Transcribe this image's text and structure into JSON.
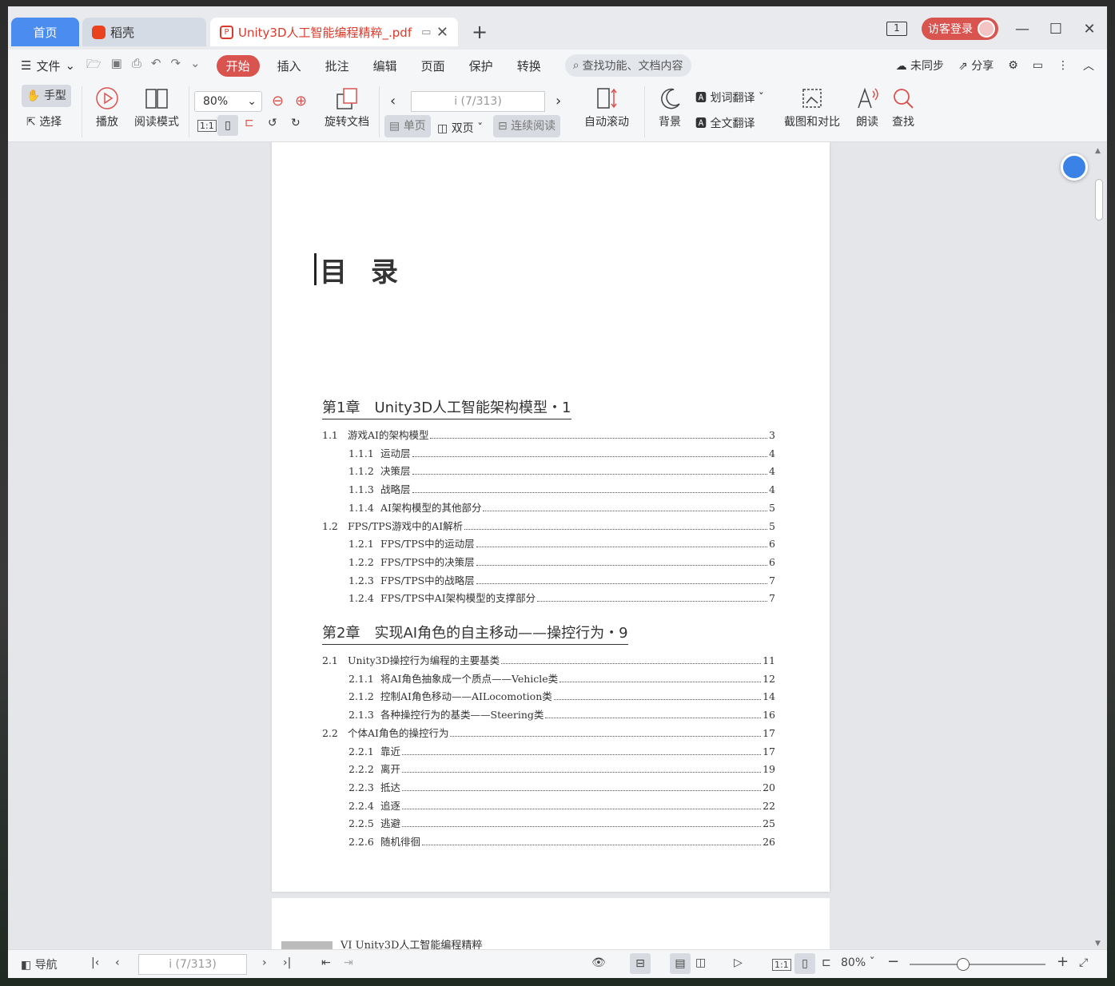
{
  "tabs": {
    "home": "首页",
    "daoke": "稻壳",
    "doc": "Unity3D人工智能编程精粹_.pdf"
  },
  "titlebar": {
    "window_count": "1",
    "login": "访客登录"
  },
  "menu": {
    "file": "文件",
    "items": [
      "开始",
      "插入",
      "批注",
      "编辑",
      "页面",
      "保护",
      "转换"
    ],
    "search_placeholder": "查找功能、文档内容",
    "sync": "未同步",
    "share": "分享"
  },
  "ribbon": {
    "hand": "手型",
    "select": "选择",
    "play": "播放",
    "read_mode": "阅读模式",
    "zoom": "80%",
    "rotate": "旋转文档",
    "page_indicator": "i (7/313)",
    "single": "单页",
    "double": "双页",
    "continuous": "连续阅读",
    "auto_scroll": "自动滚动",
    "background": "背景",
    "word_translate": "划词翻译",
    "full_translate": "全文翻译",
    "screenshot": "截图和对比",
    "read_aloud": "朗读",
    "find": "查找"
  },
  "document": {
    "toc_title": "目录",
    "chapters": [
      {
        "title": "第1章　Unity3D人工智能架构模型・1",
        "entries": [
          {
            "num": "1.1",
            "text": "游戏AI的架构模型",
            "page": "3",
            "sub": false
          },
          {
            "num": "1.1.1",
            "text": "运动层",
            "page": "4",
            "sub": true
          },
          {
            "num": "1.1.2",
            "text": "决策层",
            "page": "4",
            "sub": true
          },
          {
            "num": "1.1.3",
            "text": "战略层",
            "page": "4",
            "sub": true
          },
          {
            "num": "1.1.4",
            "text": "AI架构模型的其他部分",
            "page": "5",
            "sub": true
          },
          {
            "num": "1.2",
            "text": "FPS/TPS游戏中的AI解析",
            "page": "5",
            "sub": false
          },
          {
            "num": "1.2.1",
            "text": "FPS/TPS中的运动层",
            "page": "6",
            "sub": true
          },
          {
            "num": "1.2.2",
            "text": "FPS/TPS中的决策层",
            "page": "6",
            "sub": true
          },
          {
            "num": "1.2.3",
            "text": "FPS/TPS中的战略层",
            "page": "7",
            "sub": true
          },
          {
            "num": "1.2.4",
            "text": "FPS/TPS中AI架构模型的支撑部分",
            "page": "7",
            "sub": true
          }
        ]
      },
      {
        "title": "第2章　实现AI角色的自主移动——操控行为・9",
        "entries": [
          {
            "num": "2.1",
            "text": "Unity3D操控行为编程的主要基类",
            "page": "11",
            "sub": false
          },
          {
            "num": "2.1.1",
            "text": "将AI角色抽象成一个质点——Vehicle类",
            "page": "12",
            "sub": true
          },
          {
            "num": "2.1.2",
            "text": "控制AI角色移动——AILocomotion类",
            "page": "14",
            "sub": true
          },
          {
            "num": "2.1.3",
            "text": "各种操控行为的基类——Steering类",
            "page": "16",
            "sub": true
          },
          {
            "num": "2.2",
            "text": "个体AI角色的操控行为",
            "page": "17",
            "sub": false
          },
          {
            "num": "2.2.1",
            "text": "靠近",
            "page": "17",
            "sub": true
          },
          {
            "num": "2.2.2",
            "text": "离开",
            "page": "19",
            "sub": true
          },
          {
            "num": "2.2.3",
            "text": "抵达",
            "page": "20",
            "sub": true
          },
          {
            "num": "2.2.4",
            "text": "追逐",
            "page": "22",
            "sub": true
          },
          {
            "num": "2.2.5",
            "text": "逃避",
            "page": "25",
            "sub": true
          },
          {
            "num": "2.2.6",
            "text": "随机徘徊",
            "page": "26",
            "sub": true
          }
        ]
      }
    ],
    "next_page_header": "VI  Unity3D人工智能编程精粹"
  },
  "status": {
    "nav": "导航",
    "page_indicator": "i (7/313)",
    "zoom": "80%"
  }
}
